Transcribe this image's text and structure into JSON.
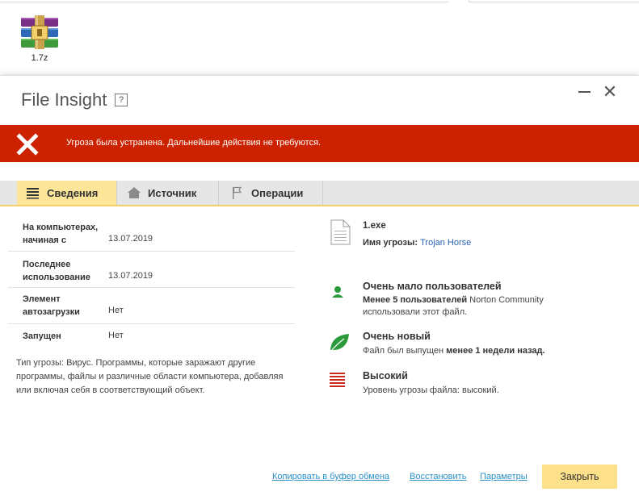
{
  "desktop": {
    "file_label": "1.7z",
    "file_icon": "rar-archive-icon"
  },
  "window": {
    "title": "File Insight",
    "help_label": "?",
    "minimize_icon": "minimize-icon",
    "close_glyph": "✕"
  },
  "alert": {
    "icon": "x-icon",
    "message": "Угроза была устранена. Дальнейшие действия не требуются.",
    "color": "#cc2200"
  },
  "tabs": [
    {
      "label": "Сведения",
      "icon": "list-icon",
      "active": true
    },
    {
      "label": "Источник",
      "icon": "home-icon",
      "active": false
    },
    {
      "label": "Операции",
      "icon": "flag-icon",
      "active": false
    }
  ],
  "details": [
    {
      "label_line1": "На компьютерах,",
      "label_line2": "начиная с",
      "value": "13.07.2019"
    },
    {
      "label_line1": "Последнее",
      "label_line2": "использование",
      "value": "13.07.2019"
    },
    {
      "label_line1": "Элемент",
      "label_line2": "автозагрузки",
      "value": "Нет"
    },
    {
      "label_line1": "Запущен",
      "value": "Нет"
    }
  ],
  "threat_description": "Тип угрозы: Вирус. Программы, которые заражают другие программы, файлы и различные области компьютера, добавляя или включая себя в соответствующий объект.",
  "file_info": {
    "name": "1.exe",
    "threat_label": "Имя угрозы:",
    "threat_name": "Trojan Horse"
  },
  "indicators": {
    "users": {
      "title": "Очень мало пользователей",
      "line1_bold": "Менее 5 пользователей",
      "line1_rest": " Norton Community",
      "line2": "использовали этот файл."
    },
    "age": {
      "title": "Очень новый",
      "text_before": "Файл был выпущен ",
      "text_bold": "менее 1 недели назад."
    },
    "risk": {
      "title": "Высокий",
      "text": "Уровень угрозы файла: высокий."
    }
  },
  "footer": {
    "copy_link": "Копировать в буфер обмена",
    "restore_link": "Восстановить",
    "settings_link": "Параметры",
    "close_button": "Закрыть"
  },
  "colors": {
    "accent_yellow": "#fde08a",
    "link_blue": "#2a8fc7",
    "green": "#2a9a3a",
    "risk_red": "#c8281e"
  }
}
